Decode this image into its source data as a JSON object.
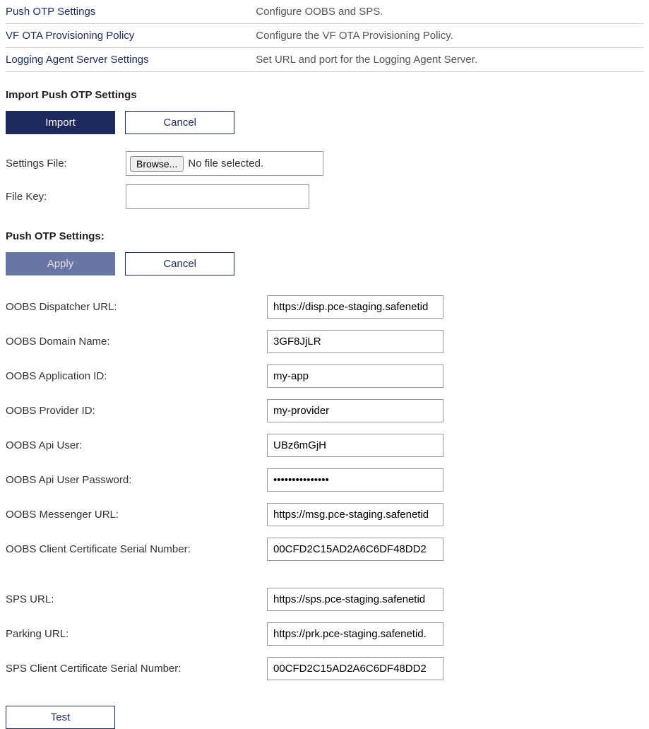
{
  "nav": [
    {
      "label": "Push OTP Settings",
      "desc": "Configure OOBS and SPS."
    },
    {
      "label": "VF OTA Provisioning Policy",
      "desc": "Configure the VF OTA Provisioning Policy."
    },
    {
      "label": "Logging Agent Server Settings",
      "desc": "Set URL and port for the Logging Agent Server."
    }
  ],
  "import": {
    "header": "Import Push OTP Settings",
    "buttons": {
      "import": "Import",
      "cancel": "Cancel"
    },
    "settings_file_label": "Settings File:",
    "browse_label": "Browse...",
    "file_status": "No file selected.",
    "file_key_label": "File Key:",
    "file_key_value": ""
  },
  "push": {
    "header": "Push OTP Settings:",
    "buttons": {
      "apply": "Apply",
      "cancel": "Cancel",
      "test": "Test"
    },
    "fields": {
      "oobs_dispatcher_url": {
        "label": "OOBS Dispatcher URL:",
        "value": "https://disp.pce-staging.safenetid"
      },
      "oobs_domain_name": {
        "label": "OOBS Domain Name:",
        "value": "3GF8JjLR"
      },
      "oobs_application_id": {
        "label": "OOBS Application ID:",
        "value": "my-app"
      },
      "oobs_provider_id": {
        "label": "OOBS Provider ID:",
        "value": "my-provider"
      },
      "oobs_api_user": {
        "label": "OOBS Api User:",
        "value": "UBz6mGjH"
      },
      "oobs_api_user_password": {
        "label": "OOBS Api User Password:",
        "value": "●●●●●●●●●●●●●●●"
      },
      "oobs_messenger_url": {
        "label": "OOBS Messenger URL:",
        "value": "https://msg.pce-staging.safenetid"
      },
      "oobs_client_cert_serial": {
        "label": "OOBS Client Certificate Serial Number:",
        "value": "00CFD2C15AD2A6C6DF48DD2"
      },
      "sps_url": {
        "label": "SPS URL:",
        "value": "https://sps.pce-staging.safenetid"
      },
      "parking_url": {
        "label": "Parking URL:",
        "value": "https://prk.pce-staging.safenetid."
      },
      "sps_client_cert_serial": {
        "label": "SPS Client Certificate Serial Number:",
        "value": "00CFD2C15AD2A6C6DF48DD2"
      }
    }
  }
}
